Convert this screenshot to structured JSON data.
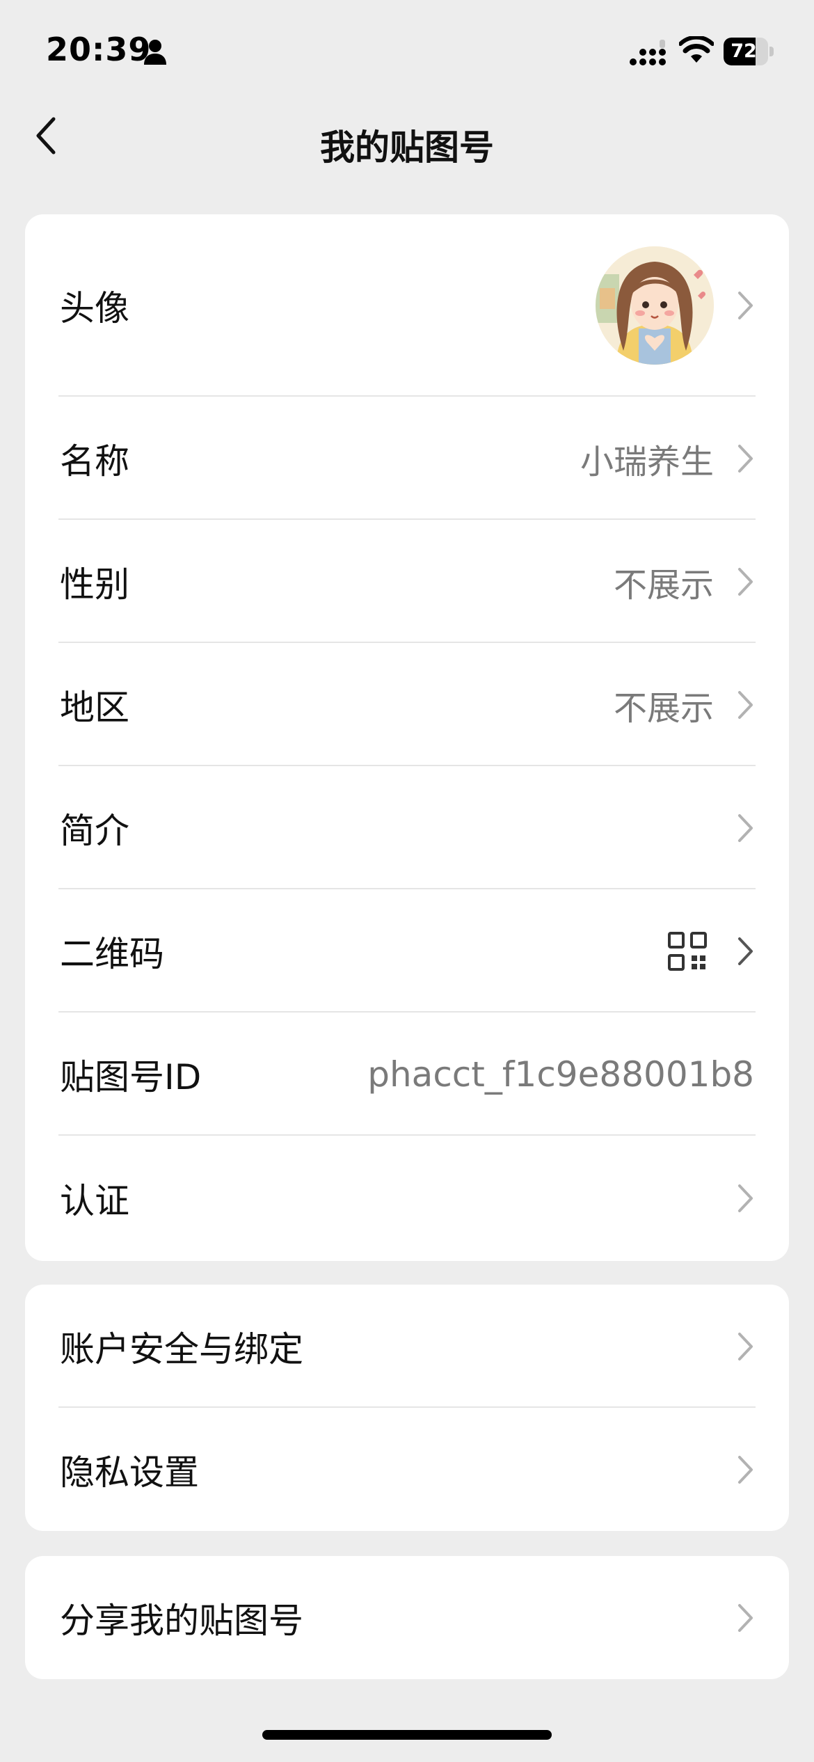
{
  "status_bar": {
    "time": "20:39",
    "battery": "72",
    "battery_level": 0.72,
    "icons": [
      "person-icon",
      "signal-icon",
      "wifi-icon",
      "battery-icon"
    ]
  },
  "nav": {
    "back_icon": "chevron-left-icon",
    "title": "我的贴图号"
  },
  "profile_rows": [
    {
      "label": "头像",
      "value": "",
      "accessory": "avatar"
    },
    {
      "label": "名称",
      "value": "小瑞养生"
    },
    {
      "label": "性别",
      "value": "不展示"
    },
    {
      "label": "地区",
      "value": "不展示"
    },
    {
      "label": "简介",
      "value": ""
    },
    {
      "label": "二维码",
      "value": "",
      "accessory": "qr-code-icon"
    },
    {
      "label": "贴图号ID",
      "value": "phacct_f1c9e88001b8"
    },
    {
      "label": "认证",
      "value": ""
    }
  ],
  "account_rows": [
    {
      "label": "账户安全与绑定"
    },
    {
      "label": "隐私设置"
    }
  ],
  "share_rows": [
    {
      "label": "分享我的贴图号"
    }
  ],
  "colors": {
    "background": "#ededed",
    "card": "#ffffff",
    "secondary_text": "#7a7a7a",
    "chevron": "#b2b2b2"
  }
}
